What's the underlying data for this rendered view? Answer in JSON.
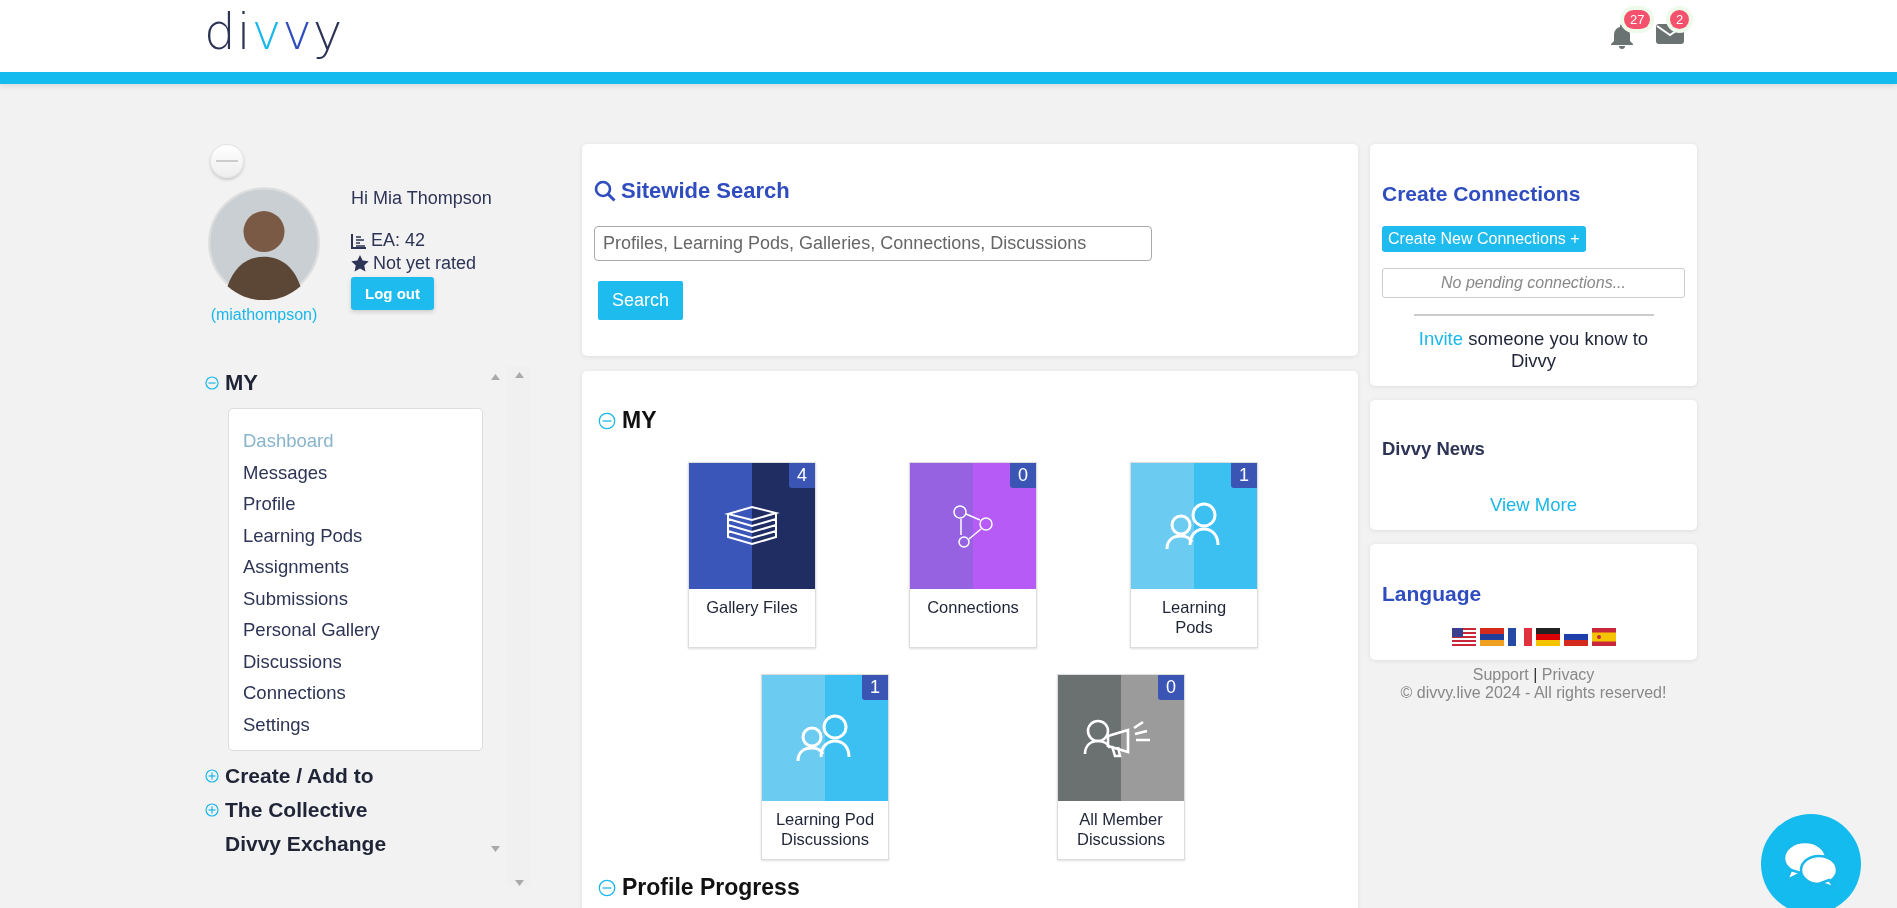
{
  "header": {
    "logo": [
      {
        "text": "di",
        "color": "#2d3455"
      },
      {
        "text": "v",
        "color": "#1ab8ea"
      },
      {
        "text": "v",
        "color": "#2f4dbf"
      },
      {
        "text": "y",
        "color": "#2d3455"
      }
    ],
    "notifications": "27",
    "messages": "2"
  },
  "profile": {
    "greeting": "Hi Mia Thompson",
    "ea": "EA: 42",
    "rating": "Not yet rated",
    "logout": "Log out",
    "username": "(miathompson)"
  },
  "sidebar": {
    "sections": [
      {
        "kind": "group",
        "label": "MY",
        "expanded": true,
        "items": [
          {
            "label": "Dashboard",
            "selected": true
          },
          {
            "label": "Messages",
            "selected": false
          },
          {
            "label": "Profile",
            "selected": false
          },
          {
            "label": "Learning Pods",
            "selected": false
          },
          {
            "label": "Assignments",
            "selected": false
          },
          {
            "label": "Submissions",
            "selected": false
          },
          {
            "label": "Personal Gallery",
            "selected": false
          },
          {
            "label": "Discussions",
            "selected": false
          },
          {
            "label": "Connections",
            "selected": false
          },
          {
            "label": "Settings",
            "selected": false
          }
        ]
      },
      {
        "kind": "group",
        "label": "Create / Add to",
        "expanded": false
      },
      {
        "kind": "group",
        "label": "The Collective",
        "expanded": false
      },
      {
        "kind": "link",
        "label": "Divvy Exchange"
      }
    ]
  },
  "search": {
    "title": "Sitewide Search",
    "placeholder": "Profiles, Learning Pods, Galleries, Connections, Discussions",
    "button": "Search"
  },
  "my": {
    "title": "MY",
    "expanded": true,
    "tiles": [
      {
        "kind": "gallery",
        "label": "Gallery Files",
        "count": "4"
      },
      {
        "kind": "connections",
        "label": "Connections",
        "count": "0"
      },
      {
        "kind": "pods",
        "label": "Learning Pods",
        "count": "1"
      },
      {
        "kind": "pods",
        "label": "Learning Pod Discussions",
        "count": "1"
      },
      {
        "kind": "members",
        "label": "All Member Discussions",
        "count": "0"
      }
    ]
  },
  "progress": {
    "title": "Profile Progress",
    "expanded": true
  },
  "connections_card": {
    "title": "Create Connections",
    "button": "Create New Connections +",
    "pending": "No pending connections...",
    "invite_link": "Invite",
    "invite_text": "someone you know to Divvy"
  },
  "news_card": {
    "title": "Divvy News",
    "link": "View More"
  },
  "language_card": {
    "title": "Language",
    "flags": [
      {
        "kind": "us"
      },
      {
        "kind": "am"
      },
      {
        "kind": "fr"
      },
      {
        "kind": "de"
      },
      {
        "kind": "ru"
      },
      {
        "kind": "es"
      }
    ]
  },
  "footer": {
    "support": "Support",
    "separator": "|",
    "privacy": "Privacy",
    "copyright": "© divvy.live 2024 - All rights reserved!"
  }
}
